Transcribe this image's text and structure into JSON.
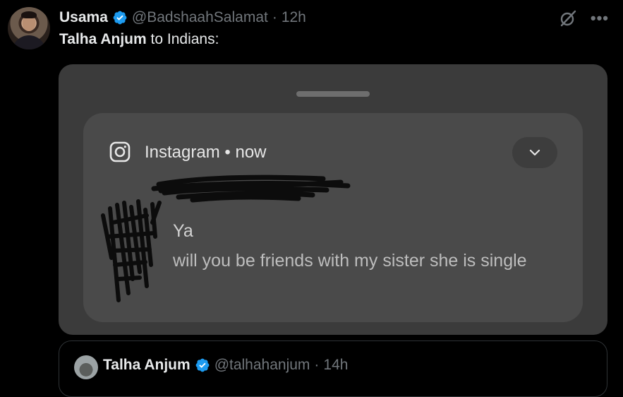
{
  "post": {
    "author": {
      "name": "Usama",
      "handle": "@BadshaahSalamat",
      "separator": "·",
      "time": "12h"
    },
    "text": {
      "bold": "Talha Anjum",
      "rest": " to Indians:"
    }
  },
  "notification": {
    "app": "Instagram",
    "separator": "•",
    "when": "now",
    "title": "Ya",
    "body": "will you be friends with my sister she is single"
  },
  "quoted": {
    "name": "Talha Anjum",
    "handle": "@talhahanjum",
    "separator": "·",
    "time": "14h"
  },
  "icons": {
    "verified": "verified-badge-icon",
    "grok": "grok-icon",
    "more": "more-options-icon",
    "instagram": "instagram-icon",
    "expand": "chevron-down-icon"
  },
  "colors": {
    "background": "#000000",
    "verified": "#1d9bf0",
    "muted_text": "#71767b",
    "media_bg": "#3b3b3b",
    "notification_bg": "#4a4a4a"
  }
}
